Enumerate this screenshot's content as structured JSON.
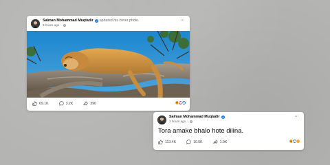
{
  "background_color": "#b4b5b3",
  "accent_color": "#1877f2",
  "post_photo": {
    "author": "Salman Mohammad Muqtadir",
    "action": "updated his cover photo.",
    "time": "3 hours ago",
    "separator": "·",
    "more": "···",
    "stats": {
      "likes": "69.1K",
      "comments": "3.2K",
      "shares": "390"
    },
    "reactions": [
      "haha-icon",
      "love-icon",
      "like-icon"
    ]
  },
  "post_text": {
    "author": "Salman Mohammad Muqtadir",
    "time": "3 hours ago",
    "separator": "·",
    "more": "···",
    "text": "Tora amake bhalo hote dilina.",
    "stats": {
      "likes": "113.4K",
      "comments": "10.5K",
      "shares": "1.9K"
    },
    "reactions": [
      "haha-icon",
      "like-icon",
      "care-icon"
    ]
  }
}
